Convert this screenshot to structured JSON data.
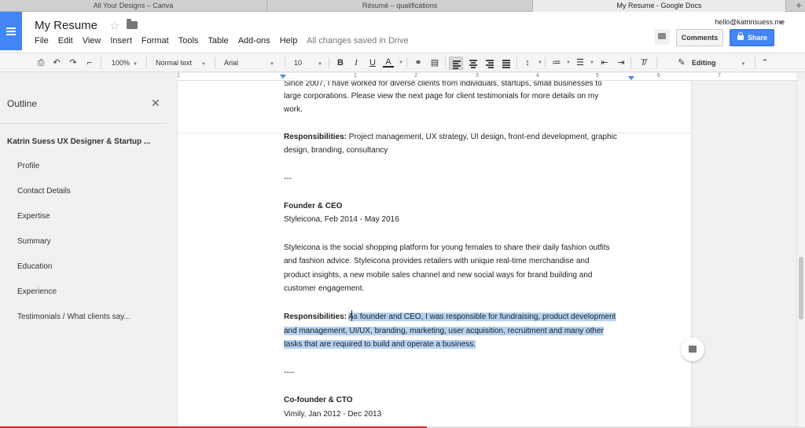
{
  "browser": {
    "tabs": [
      {
        "label": "All Your Designs – Canva",
        "active": false
      },
      {
        "label": "Résumé – qualifications",
        "active": false
      },
      {
        "label": "My Resume - Google Docs",
        "active": true
      }
    ],
    "new_tab": "+"
  },
  "header": {
    "doc_title": "My Resume",
    "menu": [
      "File",
      "Edit",
      "View",
      "Insert",
      "Format",
      "Tools",
      "Table",
      "Add-ons",
      "Help"
    ],
    "save_status": "All changes saved in Drive",
    "user_email": "hello@katrinsuess.me",
    "comments_label": "Comments",
    "share_label": "Share",
    "accent_color": "#4285f4"
  },
  "toolbar": {
    "zoom": "100%",
    "style": "Normal text",
    "font": "Arial",
    "size": "10",
    "bold": "B",
    "italic": "I",
    "underline": "U",
    "text_color": "A",
    "mode": "Editing"
  },
  "ruler": {
    "numbers": [
      "1",
      "1",
      "2",
      "3",
      "4",
      "5",
      "6",
      "7"
    ]
  },
  "outline": {
    "title": "Outline",
    "close": "✕",
    "doc_title": "Katrin Suess UX Designer & Startup ...",
    "items": [
      "Profile",
      "Contact Details",
      "Expertise",
      "Summary",
      "Education",
      "Experience",
      "Testimonials / What clients say..."
    ]
  },
  "document": {
    "intro_line1": "Since 2007, I have worked for diverse clients from individuals, startups, small businesses to",
    "intro_line2": "large corporations. Please view the next page for client testimonials for more details on my",
    "intro_line3": "work.",
    "resp1_label": "Responsibilities:",
    "resp1_text": " Project management, UX strategy, UI design, front-end development, graphic",
    "resp1_line2": "design, branding, consultancy",
    "sep1": "---",
    "role2_title": "Founder & CEO",
    "role2_org": "Styleicona, Feb 2014 - May 2016",
    "role2_desc_l1": "Styleicona is the social shopping platform for young females to share their daily fashion outfits",
    "role2_desc_l2": "and fashion advice. Styleicona provides retailers with unique real-time merchandise and",
    "role2_desc_l3": "product insights, a new mobile sales channel and new social ways for brand building and",
    "role2_desc_l4": "customer engagement.",
    "resp2_label": "Responsibilities:",
    "resp2_l1": "As founder and CEO, I was responsible for fundraising, product development",
    "resp2_l2": "and management, UI/UX, branding, marketing, user acquisition, recruitment and many other",
    "resp2_l3": "tasks that are required to build and operate a business.",
    "sep2": "----",
    "role3_title": "Co-founder & CTO",
    "role3_org": "Vimily, Jan 2012 - Dec 2013"
  },
  "video_progress": 0.53
}
